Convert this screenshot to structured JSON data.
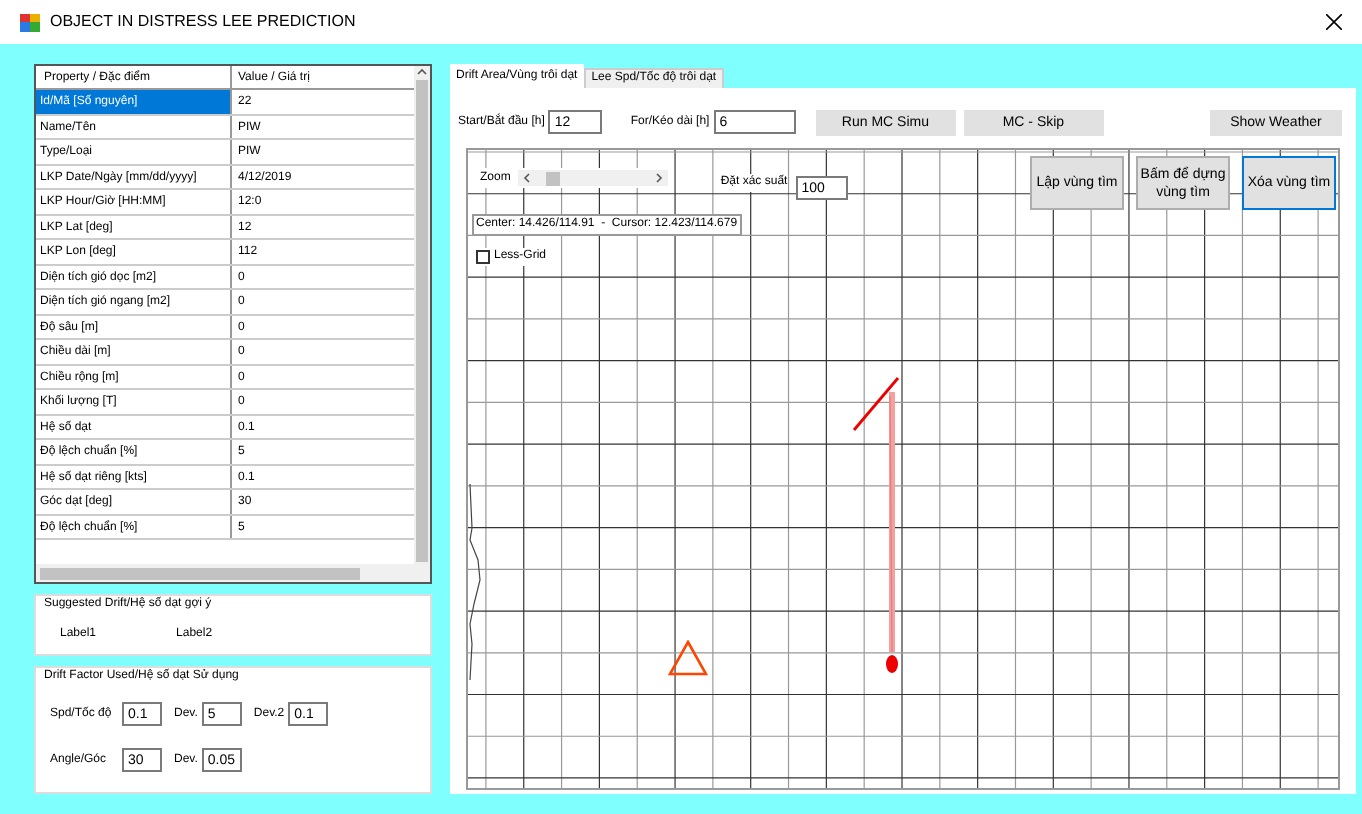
{
  "window": {
    "title": "OBJECT IN DISTRESS LEE PREDICTION"
  },
  "properties": {
    "columns": [
      "Property / Đặc điểm",
      "Value / Giá trị"
    ],
    "rows": [
      {
        "property": "Id/Mã [Số nguyên]",
        "value": "22",
        "selected": true
      },
      {
        "property": "Name/Tên",
        "value": "PIW",
        "selected": false
      },
      {
        "property": "Type/Loại",
        "value": "PIW",
        "selected": false
      },
      {
        "property": "LKP Date/Ngày [mm/dd/yyyy]",
        "value": "4/12/2019",
        "selected": false
      },
      {
        "property": "LKP Hour/Giờ [HH:MM]",
        "value": "12:0",
        "selected": false
      },
      {
        "property": "LKP Lat [deg]",
        "value": "12",
        "selected": false
      },
      {
        "property": "LKP Lon [deg]",
        "value": "112",
        "selected": false
      },
      {
        "property": "Diện tích gió dọc [m2]",
        "value": "0",
        "selected": false
      },
      {
        "property": "Diện tích gió ngang [m2]",
        "value": "0",
        "selected": false
      },
      {
        "property": "Độ sâu [m]",
        "value": "0",
        "selected": false
      },
      {
        "property": "Chiều dài [m]",
        "value": "0",
        "selected": false
      },
      {
        "property": "Chiều rộng [m]",
        "value": "0",
        "selected": false
      },
      {
        "property": "Khối lượng [T]",
        "value": "0",
        "selected": false
      },
      {
        "property": "Hệ số dạt",
        "value": "0.1",
        "selected": false
      },
      {
        "property": "Độ lệch chuẩn [%]",
        "value": "5",
        "selected": false
      },
      {
        "property": "Hệ số dạt riêng [kts]",
        "value": "0.1",
        "selected": false
      },
      {
        "property": "Góc dạt [deg]",
        "value": "30",
        "selected": false
      },
      {
        "property": "Độ lệch chuẩn [%]",
        "value": "5",
        "selected": false
      }
    ]
  },
  "suggested": {
    "title": "Suggested Drift/Hệ số dạt gợi ý",
    "labels": [
      "Label1",
      "Label2"
    ]
  },
  "drift_factor": {
    "title": "Drift Factor Used/Hệ số dạt Sử dụng",
    "rows": [
      [
        {
          "label": "Spd/Tốc độ",
          "value": "0.1"
        },
        {
          "label": "Dev.",
          "value": "5"
        },
        {
          "label": "Dev.2",
          "value": "0.1"
        }
      ],
      [
        {
          "label": "Angle/Góc",
          "value": "30"
        },
        {
          "label": "Dev.",
          "value": "0.05"
        }
      ]
    ]
  },
  "tabs": [
    {
      "label": "Drift Area/Vùng trôi dạt",
      "selected": true
    },
    {
      "label": "Lee Spd/Tốc độ trôi dạt",
      "selected": false
    }
  ],
  "toolbar": {
    "fields": [
      {
        "label": "Start/Bắt đầu [h]",
        "value": "12"
      },
      {
        "label": "For/Kéo dài [h]",
        "value": "6"
      }
    ],
    "buttons": [
      "Run MC Simu",
      "MC - Skip",
      "Show Weather"
    ]
  },
  "map": {
    "zoom_label": "Zoom",
    "zoom": {
      "level": 0.1
    },
    "probability": {
      "label": "Đặt xác suất",
      "value": "100"
    },
    "buttons": [
      {
        "label": "Lập vùng tìm",
        "focused": false
      },
      {
        "label": "Bấm để dựng vùng tìm",
        "focused": false
      },
      {
        "label": "Xóa vùng tìm",
        "focused": true
      }
    ],
    "coordinates": "Center: 14.426/114.91  -  Cursor: 12.423/114.679",
    "less_grid": {
      "label": "Less-Grid",
      "checked": false
    }
  }
}
